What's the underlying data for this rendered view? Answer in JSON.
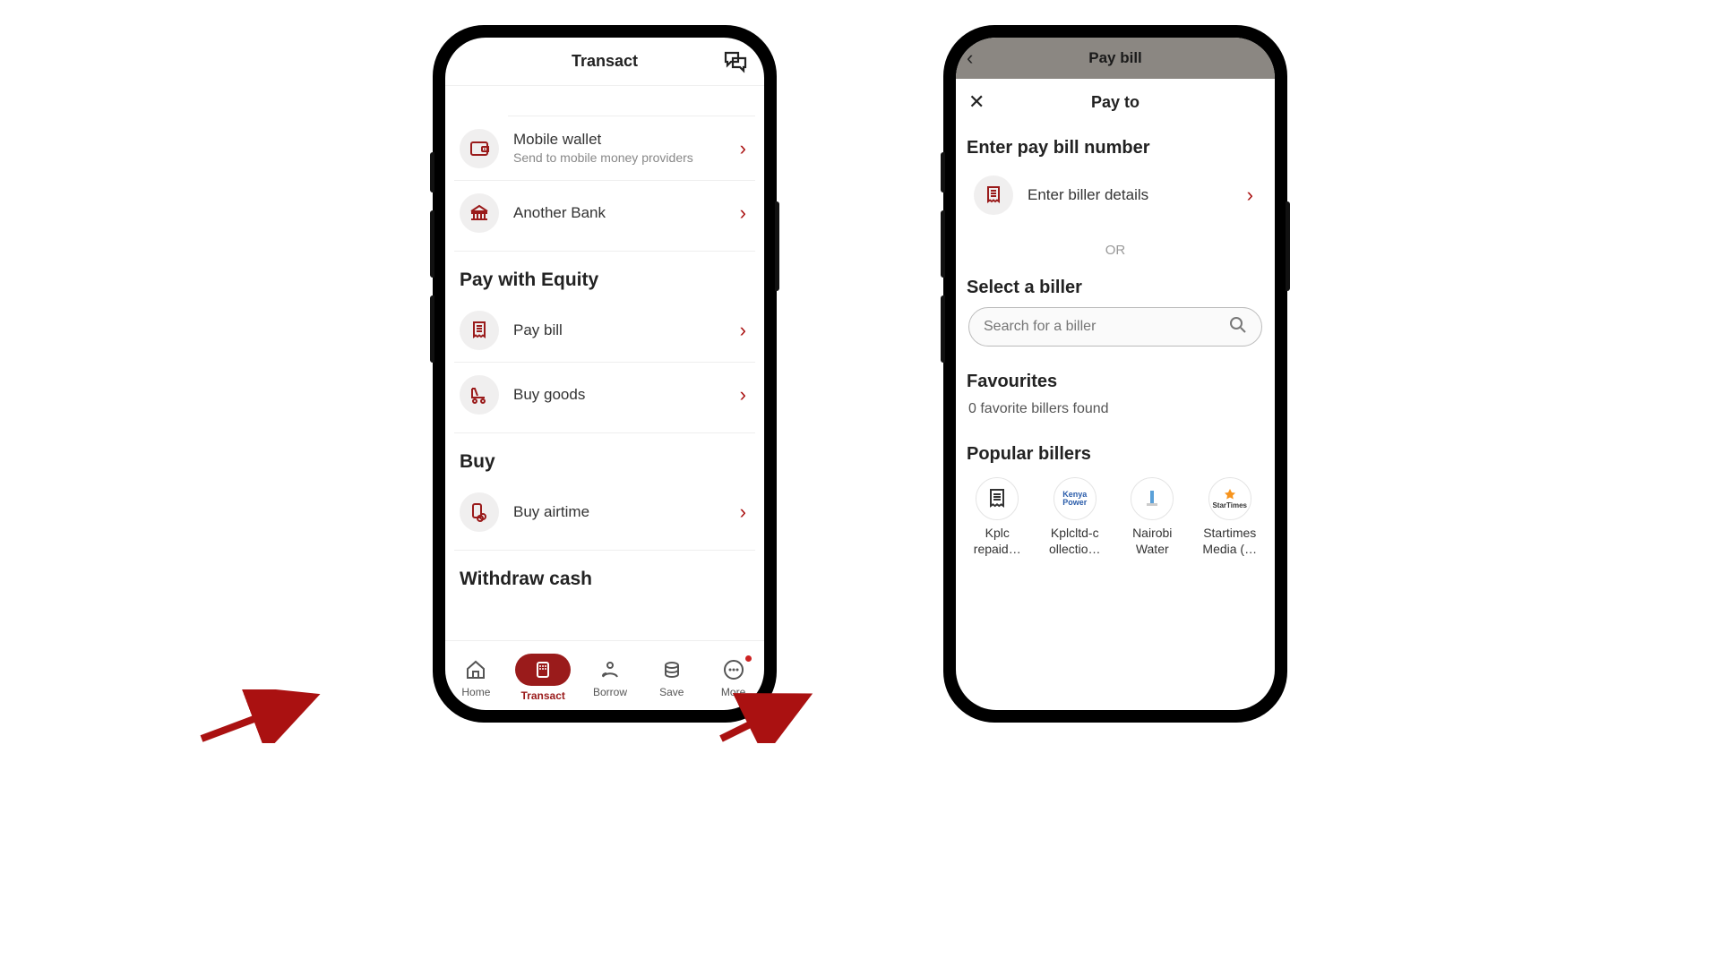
{
  "screen1": {
    "header_title": "Transact",
    "rows": {
      "mobile_wallet": {
        "title": "Mobile wallet",
        "sub": "Send to mobile money providers"
      },
      "another_bank": {
        "title": "Another Bank"
      }
    },
    "sections": {
      "pay_with_equity": "Pay with Equity",
      "pay_bill": "Pay bill",
      "buy_goods": "Buy goods",
      "buy": "Buy",
      "buy_airtime": "Buy airtime",
      "withdraw_cash": "Withdraw cash"
    },
    "tabs": {
      "home": "Home",
      "transact": "Transact",
      "borrow": "Borrow",
      "save": "Save",
      "more": "More"
    }
  },
  "screen2": {
    "topbar_title": "Pay bill",
    "sheet_title": "Pay to",
    "enter_paybill_label": "Enter pay bill number",
    "enter_biller_details": "Enter biller details",
    "or": "OR",
    "select_biller": "Select a biller",
    "search_placeholder": "Search for a biller",
    "favourites": "Favourites",
    "favourites_sub": "0 favorite billers found",
    "popular_billers": "Popular billers",
    "billers": {
      "b0": "Kplc repaid…",
      "b1": "Kplcltd-c ollectio…",
      "b2": "Nairobi Water",
      "b3": "Startimes Media (…"
    }
  }
}
